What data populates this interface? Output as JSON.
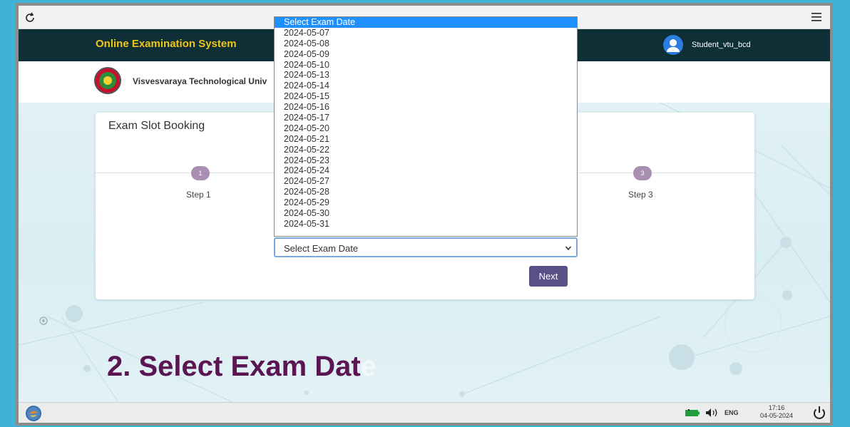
{
  "app": {
    "title": "Online Examination System",
    "user_name": "Student_vtu_bcd",
    "university": "Visvesvaraya Technological Univ"
  },
  "card": {
    "title": "Exam Slot Booking",
    "steps": [
      {
        "num": "1",
        "label": "Step 1"
      },
      {
        "num": "3",
        "label": "Step 3"
      }
    ],
    "select_value": "Select Exam Date",
    "next_label": "Next"
  },
  "dropdown": {
    "options": [
      "Select Exam Date",
      "2024-05-07",
      "2024-05-08",
      "2024-05-09",
      "2024-05-10",
      "2024-05-13",
      "2024-05-14",
      "2024-05-15",
      "2024-05-16",
      "2024-05-17",
      "2024-05-20",
      "2024-05-21",
      "2024-05-22",
      "2024-05-23",
      "2024-05-24",
      "2024-05-27",
      "2024-05-28",
      "2024-05-29",
      "2024-05-30",
      "2024-05-31"
    ],
    "selected_index": 0
  },
  "caption": {
    "main": "2. Select Exam Dat",
    "faded": "e"
  },
  "taskbar": {
    "lang": "ENG",
    "time": "17:16",
    "date": "04-05-2024"
  },
  "colors": {
    "header_bg": "#0e2f36",
    "title_yellow": "#f0c419",
    "next_button": "#5a4f87",
    "caption": "#5b1553",
    "selected_option": "#1e90ff"
  }
}
